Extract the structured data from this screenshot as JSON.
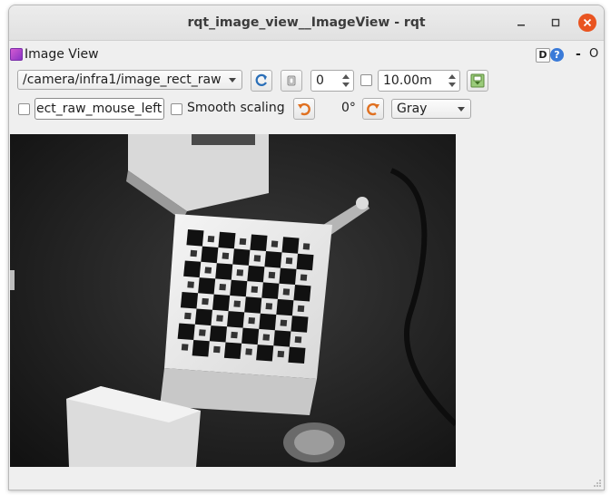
{
  "window": {
    "title": "rqt_image_view__ImageView - rqt"
  },
  "dock": {
    "title": "Image View",
    "d_label": "D",
    "help_label": "?",
    "dash_label": "-",
    "close_label": "O"
  },
  "toolbar": {
    "topic": "/camera/infra1/image_rect_raw",
    "spin_value": "0",
    "max_value": "10.00m",
    "mouse_topic": "ect_raw_mouse_left",
    "smooth_label": "Smooth scaling",
    "rotation_value": "0°",
    "color_scheme": "Gray"
  },
  "colors": {
    "accent_close": "#e95420",
    "help_blue": "#3a7ad8",
    "refresh_blue": "#2a6fb8",
    "rotate_orange": "#e07020"
  },
  "icons": {
    "refresh": "refresh-icon",
    "save_image": "save-image-icon",
    "rotate_left": "rotate-left-icon",
    "rotate_right": "rotate-right-icon",
    "zoom": "zoom-icon"
  }
}
